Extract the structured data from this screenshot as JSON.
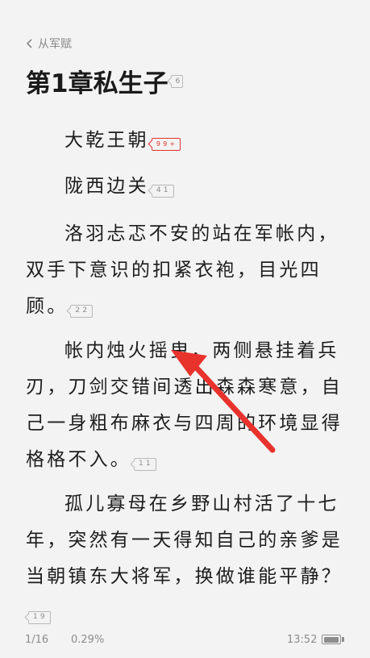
{
  "nav": {
    "back_label": "从军赋"
  },
  "chapter": {
    "title": "第1章私生子",
    "comment_count": "6"
  },
  "paragraphs": [
    {
      "text": "大乾王朝",
      "comments": "99+"
    },
    {
      "text": "陇西边关",
      "comments": "41"
    },
    {
      "text": "洛羽忐忑不安的站在军帐内，双手下意识的扣紧衣袍，目光四顾。",
      "comments": "22"
    },
    {
      "text": "帐内烛火摇曳，两侧悬挂着兵刃，刀剑交错间透出森森寒意，自己一身粗布麻衣与四周的环境显得格格不入。",
      "comments": "11"
    },
    {
      "text": "孤儿寡母在乡野山村活了十七年，突然有一天得知自己的亲爹是当朝镇东大将军，换做谁能平静？",
      "comments": "19"
    }
  ],
  "footer": {
    "page": "1/16",
    "progress": "0.29%",
    "time": "13:52",
    "battery_level": 0.95
  },
  "colors": {
    "background": "#f3f3f3",
    "hot_badge": "#e0322f",
    "annotation_arrow": "#e8322c"
  },
  "icons": {
    "back": "chevron-left-icon",
    "battery": "battery-icon",
    "annotation": "red-arrow-annotation"
  }
}
